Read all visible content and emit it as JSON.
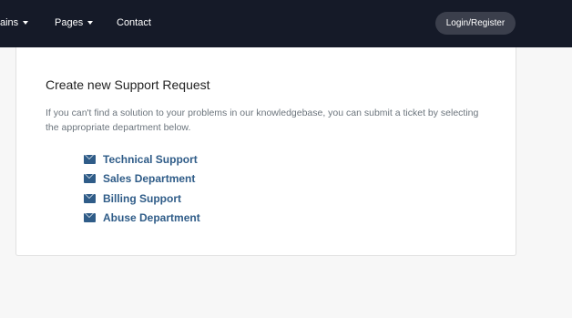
{
  "nav": {
    "items": [
      {
        "label": "ains",
        "has_caret": true
      },
      {
        "label": "Pages",
        "has_caret": true
      },
      {
        "label": "Contact",
        "has_caret": false
      }
    ],
    "login_label": "Login/Register"
  },
  "card": {
    "title": "Create new Support Request",
    "description": "If you can't find a solution to your problems in our knowledgebase, you can submit a ticket by selecting the appropriate department below.",
    "departments": [
      {
        "label": "Technical Support",
        "icon": "envelope-icon"
      },
      {
        "label": "Sales Department",
        "icon": "envelope-icon"
      },
      {
        "label": "Billing Support",
        "icon": "envelope-icon"
      },
      {
        "label": "Abuse Department",
        "icon": "envelope-icon"
      }
    ]
  },
  "colors": {
    "nav_background": "#151a28",
    "login_button": "#3b3f4c",
    "link": "#2f5c88",
    "page_background": "#f7f7f7"
  }
}
